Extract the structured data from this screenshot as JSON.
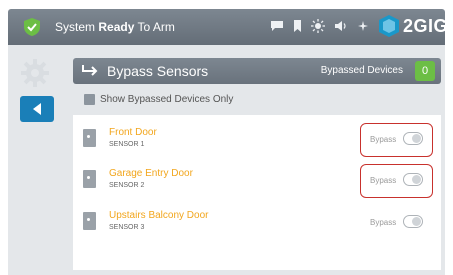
{
  "status_bar": {
    "status_prefix": "System",
    "status_strong": "Ready",
    "status_suffix": " To Arm",
    "icons": [
      "chat-icon",
      "bookmark-icon",
      "brightness-icon",
      "volume-icon",
      "wifi-icon"
    ],
    "brand": "2GIG"
  },
  "title_bar": {
    "title": "Bypass Sensors",
    "bypassed_label": "Bypassed Devices",
    "bypassed_count": "0"
  },
  "filter": {
    "label": "Show Bypassed Devices Only"
  },
  "sensors": [
    {
      "name": "Front Door",
      "sub": "SENSOR 1",
      "bypass_label": "Bypass"
    },
    {
      "name": "Garage Entry Door",
      "sub": "SENSOR 2",
      "bypass_label": "Bypass"
    },
    {
      "name": "Upstairs Balcony Door",
      "sub": "SENSOR 3",
      "bypass_label": "Bypass"
    }
  ],
  "colors": {
    "accent_blue": "#1a7fb8",
    "sensor_name": "#f2a61d",
    "highlight_red": "#c8312d",
    "badge_green": "#6cbe45"
  }
}
